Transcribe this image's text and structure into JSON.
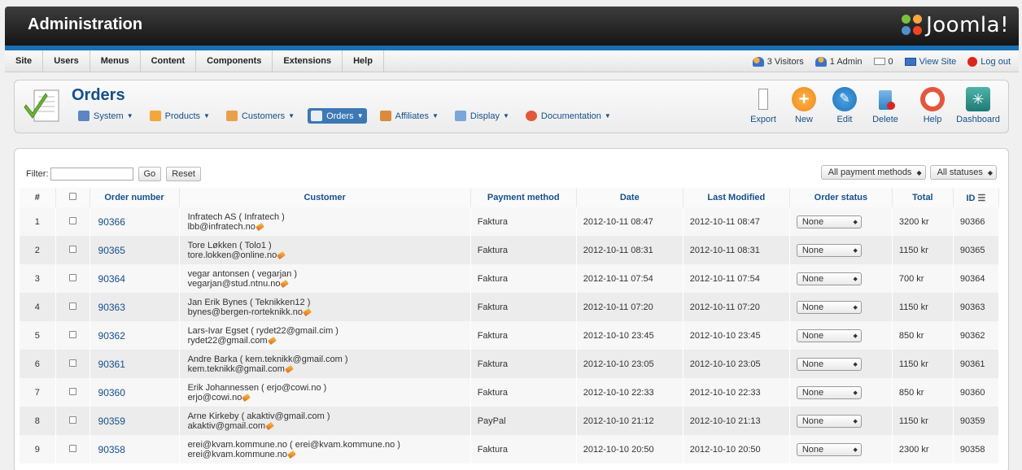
{
  "header": {
    "title": "Administration",
    "logo_text": "Joomla!"
  },
  "menu": [
    "Site",
    "Users",
    "Menus",
    "Content",
    "Components",
    "Extensions",
    "Help"
  ],
  "status": {
    "visitors": "3 Visitors",
    "admin": "1 Admin",
    "messages": "0",
    "view_site": "View Site",
    "logout": "Log out"
  },
  "page_title": "Orders",
  "subnav": [
    "System",
    "Products",
    "Customers",
    "Orders",
    "Affiliates",
    "Display",
    "Documentation"
  ],
  "toolbar": [
    "Export",
    "New",
    "Edit",
    "Delete",
    "Help",
    "Dashboard"
  ],
  "filter": {
    "label": "Filter:",
    "go": "Go",
    "reset": "Reset",
    "value": ""
  },
  "selects": {
    "payment": "All payment methods",
    "status": "All statuses"
  },
  "columns": [
    "#",
    "Order number",
    "Customer",
    "Payment method",
    "Date",
    "Last Modified",
    "Order status",
    "Total",
    "ID"
  ],
  "orders": [
    {
      "n": "1",
      "order": "90366",
      "customer": "Infratech AS ( Infratech )",
      "email": "lbb@infratech.no",
      "payment": "Faktura",
      "date": "2012-10-11 08:47",
      "modified": "2012-10-11 08:47",
      "status": "None",
      "total": "3200 kr",
      "id": "90366"
    },
    {
      "n": "2",
      "order": "90365",
      "customer": "Tore Løkken ( Tolo1 )",
      "email": "tore.lokken@online.no",
      "payment": "Faktura",
      "date": "2012-10-11 08:31",
      "modified": "2012-10-11 08:31",
      "status": "None",
      "total": "1150 kr",
      "id": "90365"
    },
    {
      "n": "3",
      "order": "90364",
      "customer": "vegar antonsen ( vegarjan )",
      "email": "vegarjan@stud.ntnu.no",
      "payment": "Faktura",
      "date": "2012-10-11 07:54",
      "modified": "2012-10-11 07:54",
      "status": "None",
      "total": "700 kr",
      "id": "90364"
    },
    {
      "n": "4",
      "order": "90363",
      "customer": "Jan Erik Bynes ( Teknikken12 )",
      "email": "bynes@bergen-rorteknikk.no",
      "payment": "Faktura",
      "date": "2012-10-11 07:20",
      "modified": "2012-10-11 07:20",
      "status": "None",
      "total": "1150 kr",
      "id": "90363"
    },
    {
      "n": "5",
      "order": "90362",
      "customer": "Lars-Ivar Egset ( rydet22@gmail.cim )",
      "email": "rydet22@gmail.com",
      "payment": "Faktura",
      "date": "2012-10-10 23:45",
      "modified": "2012-10-10 23:45",
      "status": "None",
      "total": "850 kr",
      "id": "90362"
    },
    {
      "n": "6",
      "order": "90361",
      "customer": "Andre Barka ( kem.teknikk@gmail.com )",
      "email": "kem.teknikk@gmail.com",
      "payment": "Faktura",
      "date": "2012-10-10 23:05",
      "modified": "2012-10-10 23:05",
      "status": "None",
      "total": "1150 kr",
      "id": "90361"
    },
    {
      "n": "7",
      "order": "90360",
      "customer": "Erik Johannessen ( erjo@cowi.no )",
      "email": "erjo@cowi.no",
      "payment": "Faktura",
      "date": "2012-10-10 22:33",
      "modified": "2012-10-10 22:33",
      "status": "None",
      "total": "850 kr",
      "id": "90360"
    },
    {
      "n": "8",
      "order": "90359",
      "customer": "Arne Kirkeby ( akaktiv@gmail.com )",
      "email": "akaktiv@gmail.com",
      "payment": "PayPal",
      "date": "2012-10-10 21:12",
      "modified": "2012-10-10 21:13",
      "status": "None",
      "total": "1150 kr",
      "id": "90359"
    },
    {
      "n": "9",
      "order": "90358",
      "customer": "erei@kvam.kommune.no ( erei@kvam.kommune.no )",
      "email": "erei@kvam.kommune.no",
      "payment": "Faktura",
      "date": "2012-10-10 20:50",
      "modified": "2012-10-10 20:50",
      "status": "None",
      "total": "2300 kr",
      "id": "90358"
    }
  ]
}
